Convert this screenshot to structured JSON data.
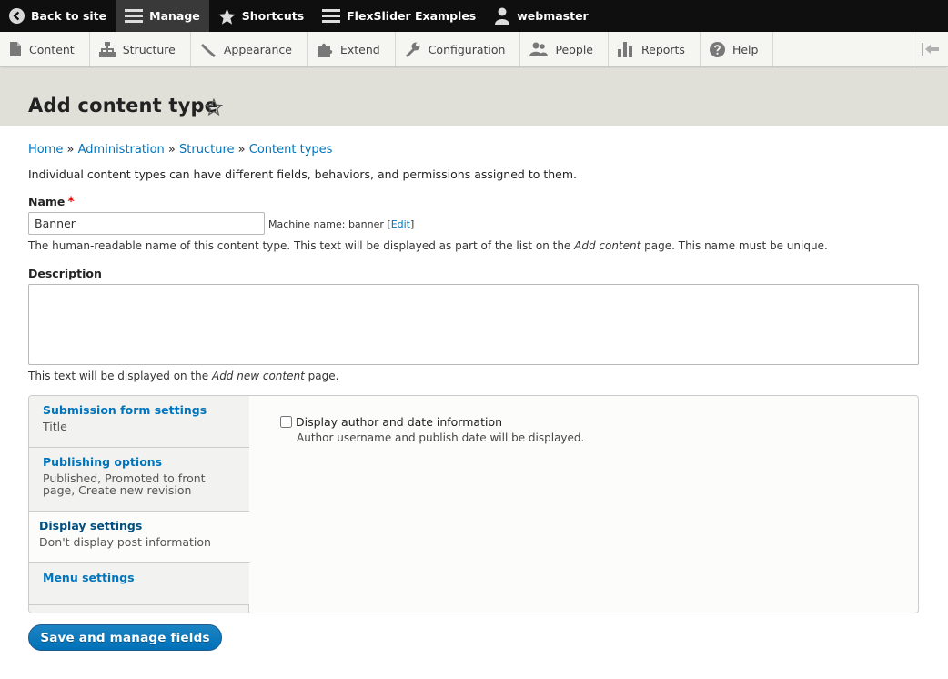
{
  "toolbar": {
    "back_label": "Back to site",
    "manage_label": "Manage",
    "shortcuts_label": "Shortcuts",
    "flexslider_label": "FlexSlider Examples",
    "user_label": "webmaster"
  },
  "menu": {
    "items": [
      {
        "label": "Content",
        "icon": "document-icon"
      },
      {
        "label": "Structure",
        "icon": "sitemap-icon"
      },
      {
        "label": "Appearance",
        "icon": "paintbrush-icon"
      },
      {
        "label": "Extend",
        "icon": "puzzle-icon"
      },
      {
        "label": "Configuration",
        "icon": "wrench-icon"
      },
      {
        "label": "People",
        "icon": "people-icon"
      },
      {
        "label": "Reports",
        "icon": "bar-chart-icon"
      },
      {
        "label": "Help",
        "icon": "help-icon"
      }
    ]
  },
  "page": {
    "title": "Add content type",
    "breadcrumb": {
      "home": "Home",
      "sep": "»",
      "administration": "Administration",
      "structure": "Structure",
      "content_types": "Content types"
    },
    "intro": "Individual content types can have different fields, behaviors, and permissions assigned to them."
  },
  "form": {
    "name_label": "Name",
    "required_mark": "*",
    "name_value": "Banner",
    "machine_name_prefix": "Machine name: banner [",
    "machine_name_edit": "Edit",
    "machine_name_suffix": "]",
    "name_help_1": "The human-readable name of this content type. This text will be displayed as part of the list on the ",
    "name_help_em": "Add content",
    "name_help_2": " page. This name must be unique.",
    "description_label": "Description",
    "description_value": "",
    "desc_help_1": "This text will be displayed on the ",
    "desc_help_em": "Add new content",
    "desc_help_2": " page."
  },
  "vertical_tabs": {
    "tabs": [
      {
        "title": "Submission form settings",
        "summary": "Title"
      },
      {
        "title": "Publishing options",
        "summary_line1": "Published, Promoted to front",
        "summary_line2": "page, Create new revision"
      },
      {
        "title": "Display settings",
        "summary": "Don't display post information"
      },
      {
        "title": "Menu settings",
        "summary": ""
      }
    ],
    "selected_index": 2,
    "panel": {
      "checkbox_label": "Display author and date information",
      "checkbox_checked": false,
      "checkbox_description": "Author username and publish date will be displayed."
    }
  },
  "actions": {
    "save_label": "Save and manage fields"
  },
  "colors": {
    "link": "#0074bd",
    "primary_button": "#0071b8",
    "header_bg": "#e0e0d8",
    "toolbar_bg": "#0f0f0f",
    "required": "#ee0000"
  }
}
